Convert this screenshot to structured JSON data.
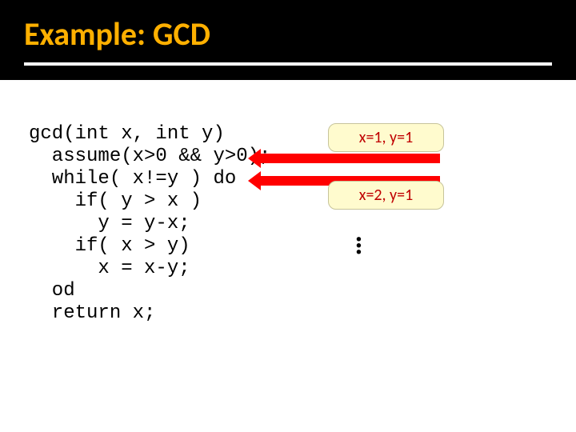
{
  "title": "Example: GCD",
  "code": "gcd(int x, int y)\n  assume(x>0 && y>0);\n  while( x!=y ) do\n    if( y > x )\n      y = y-x;\n    if( x > y)\n      x = x-y;\n  od\n  return x;",
  "annotations": {
    "a1": "x=1, y=1",
    "a2": "x=2, y=1"
  },
  "ellipsis": "…"
}
